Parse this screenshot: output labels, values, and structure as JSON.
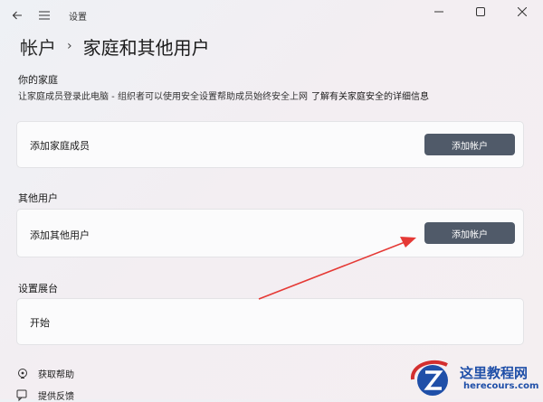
{
  "window": {
    "title": "设置"
  },
  "breadcrumb": {
    "parent": "帐户",
    "current": "家庭和其他用户"
  },
  "family": {
    "heading": "你的家庭",
    "description": "让家庭成员登录此电脑 - 组织者可以使用安全设置帮助成员始终安全上网",
    "link": "了解有关家庭安全的详细信息",
    "card_label": "添加家庭成员",
    "button_label": "添加帐户"
  },
  "other_users": {
    "heading": "其他用户",
    "card_label": "添加其他用户",
    "button_label": "添加帐户"
  },
  "kiosk": {
    "heading": "设置展台",
    "card_label": "开始"
  },
  "footer": {
    "help": "获取帮助",
    "feedback": "提供反馈"
  },
  "watermark": {
    "title": "这里教程网",
    "url": "herecours.com"
  },
  "colors": {
    "button": "#505a69",
    "arrow": "#e53935",
    "watermark": "#1f4fa8"
  }
}
